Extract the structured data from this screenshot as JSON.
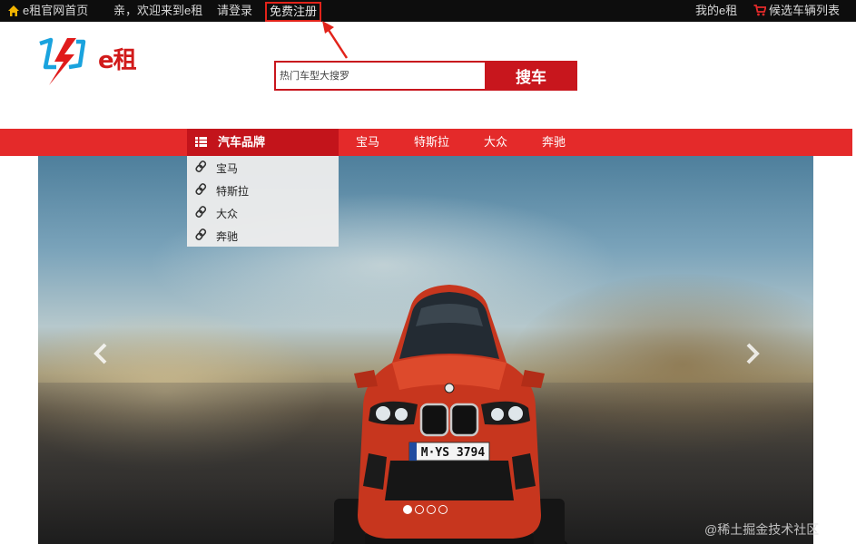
{
  "topbar": {
    "home_link": "e租官网首页",
    "welcome": "亲，欢迎来到e租",
    "login": "请登录",
    "register": "免费注册",
    "my_account": "我的e租",
    "cart": "候选车辆列表"
  },
  "header": {
    "logo_text": "e租",
    "search_placeholder": "热门车型大搜罗",
    "search_button": "搜车"
  },
  "nav": {
    "brand_label": "汽车品牌",
    "links": [
      "宝马",
      "特斯拉",
      "大众",
      "奔驰"
    ]
  },
  "dropdown": {
    "items": [
      "宝马",
      "特斯拉",
      "大众",
      "奔驰"
    ]
  },
  "banner": {
    "plate_text": "M·YS 3794",
    "slide_count": 4,
    "active_slide": 1
  },
  "watermark": "@稀土掘金技术社区",
  "colors": {
    "topbar_bg": "#0d0d0d",
    "nav_red": "#e42a2a",
    "brand_red": "#c3141b",
    "search_red": "#c8161d",
    "annotation_red": "#e2231a"
  },
  "icons": {
    "home": "home-icon",
    "cart": "cart-icon",
    "list": "list-icon",
    "link": "link-icon",
    "prev": "chevron-left-icon",
    "next": "chevron-right-icon"
  }
}
